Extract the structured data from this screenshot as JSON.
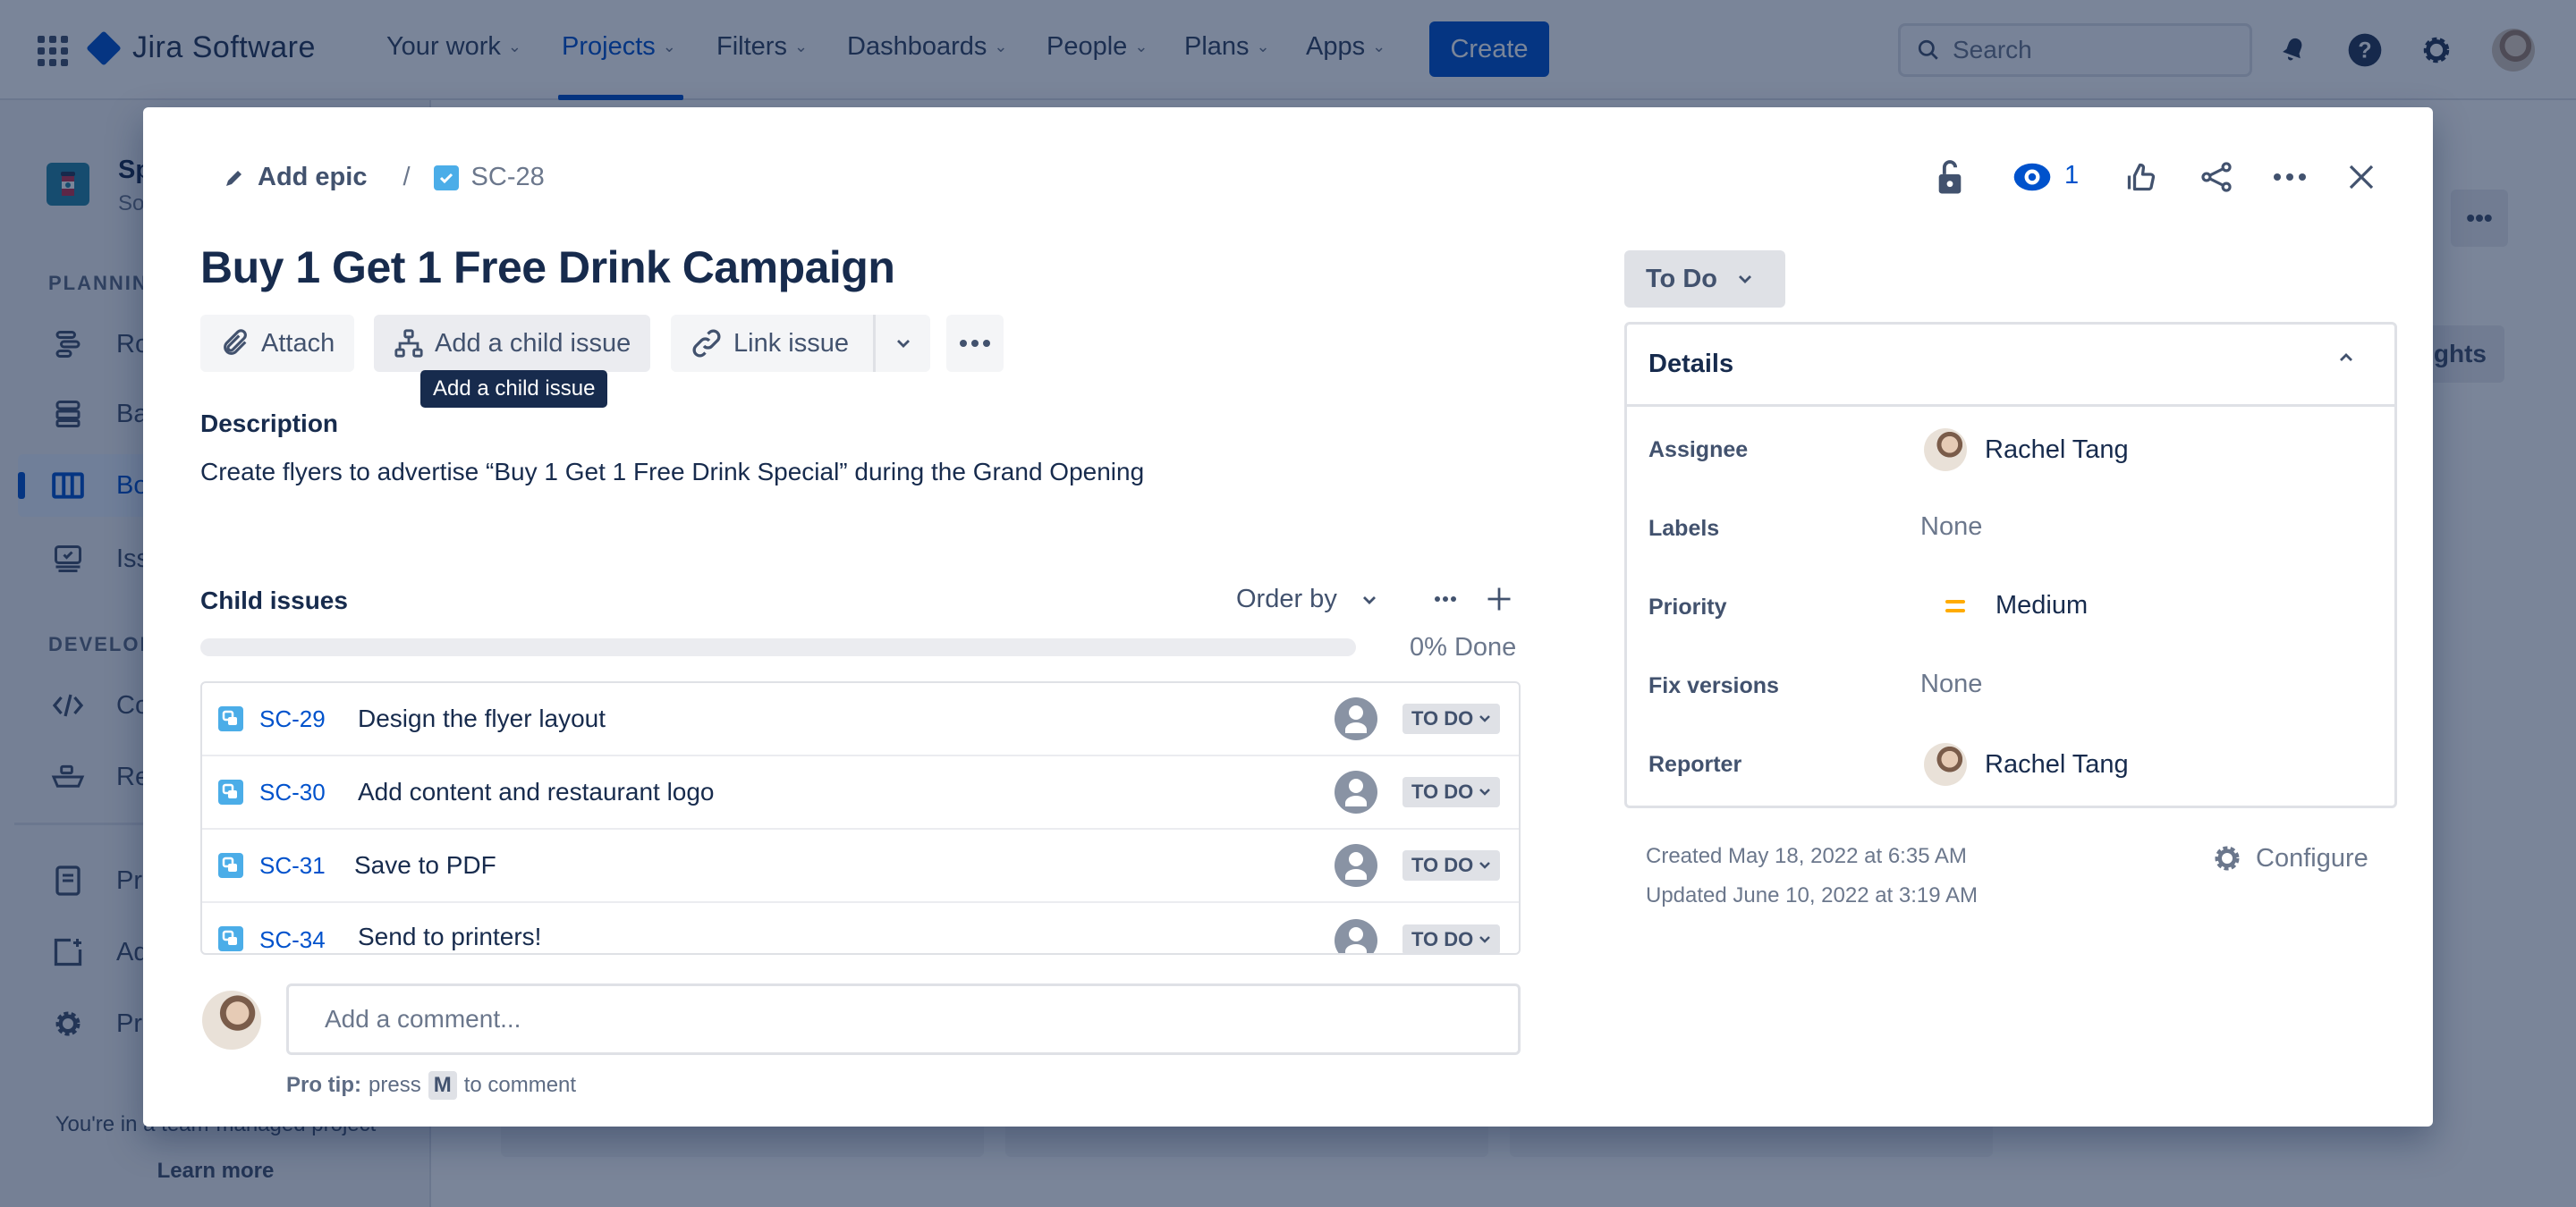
{
  "topnav": {
    "product": "Jira Software",
    "items": [
      {
        "label": "Your work",
        "active": false
      },
      {
        "label": "Projects",
        "active": true
      },
      {
        "label": "Filters",
        "active": false
      },
      {
        "label": "Dashboards",
        "active": false
      },
      {
        "label": "People",
        "active": false
      },
      {
        "label": "Plans",
        "active": false
      },
      {
        "label": "Apps",
        "active": false
      }
    ],
    "create_label": "Create",
    "search_placeholder": "Search"
  },
  "sidebar": {
    "project_name": "Sp",
    "project_sub": "So",
    "planning_label": "PLANNING",
    "development_label": "DEVELOPMENT",
    "planning_items": [
      {
        "label": "Roadmap",
        "icon": "roadmap-icon"
      },
      {
        "label": "Backlog",
        "icon": "backlog-icon"
      },
      {
        "label": "Board",
        "icon": "board-icon",
        "active": true
      },
      {
        "label": "Issues",
        "icon": "issues-icon"
      }
    ],
    "dev_items": [
      {
        "label": "Code",
        "icon": "code-icon"
      },
      {
        "label": "Releases",
        "icon": "releases-icon"
      }
    ],
    "other_items": [
      {
        "label": "Project pages",
        "icon": "pages-icon"
      },
      {
        "label": "Add shortcut",
        "icon": "add-shortcut-icon"
      },
      {
        "label": "Project settings",
        "icon": "settings-icon"
      }
    ],
    "footer_text": "You're in a team-managed project",
    "learn_more": "Learn more"
  },
  "background": {
    "insights_label": "Insights"
  },
  "modal": {
    "breadcrumb": {
      "add_epic": "Add epic",
      "separator": "/",
      "issue_key": "SC-28"
    },
    "watch_count": "1",
    "title": "Buy 1 Get 1 Free Drink Campaign",
    "toolbar": {
      "attach": "Attach",
      "add_child": "Add a child issue",
      "link_issue": "Link issue",
      "tooltip": "Add a child issue"
    },
    "description_label": "Description",
    "description": "Create flyers to advertise “Buy 1 Get 1 Free Drink Special” during the Grand Opening",
    "child_issues": {
      "label": "Child issues",
      "order_by": "Order by",
      "progress_percent": 0,
      "progress_text": "0% Done",
      "items": [
        {
          "key": "SC-29",
          "summary": "Design the flyer layout",
          "status": "TO DO"
        },
        {
          "key": "SC-30",
          "summary": "Add content and restaurant logo",
          "status": "TO DO"
        },
        {
          "key": "SC-31",
          "summary": "Save to PDF",
          "status": "TO DO"
        },
        {
          "key": "SC-34",
          "summary": "Send to printers!",
          "status": "TO DO"
        }
      ]
    },
    "comment": {
      "placeholder": "Add a comment...",
      "protip_bold": "Pro tip:",
      "protip_press": "press",
      "protip_key": "M",
      "protip_rest": "to comment"
    },
    "status": "To Do",
    "details": {
      "header": "Details",
      "fields": [
        {
          "label": "Assignee",
          "value": "Rachel Tang",
          "type": "user"
        },
        {
          "label": "Labels",
          "value": "None",
          "type": "none"
        },
        {
          "label": "Priority",
          "value": "Medium",
          "type": "priority"
        },
        {
          "label": "Fix versions",
          "value": "None",
          "type": "none"
        },
        {
          "label": "Reporter",
          "value": "Rachel Tang",
          "type": "user"
        }
      ]
    },
    "created": "Created May 18, 2022 at 6:35 AM",
    "updated": "Updated June 10, 2022 at 3:19 AM",
    "configure": "Configure"
  },
  "colors": {
    "brand": "#0052cc",
    "priority_medium": "#ffab00",
    "issue_type": "#4bade8"
  }
}
